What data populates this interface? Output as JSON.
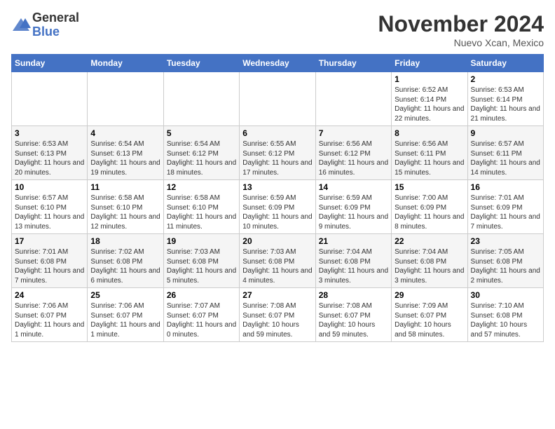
{
  "logo": {
    "general": "General",
    "blue": "Blue"
  },
  "header": {
    "month": "November 2024",
    "location": "Nuevo Xcan, Mexico"
  },
  "weekdays": [
    "Sunday",
    "Monday",
    "Tuesday",
    "Wednesday",
    "Thursday",
    "Friday",
    "Saturday"
  ],
  "weeks": [
    [
      {
        "day": "",
        "info": ""
      },
      {
        "day": "",
        "info": ""
      },
      {
        "day": "",
        "info": ""
      },
      {
        "day": "",
        "info": ""
      },
      {
        "day": "",
        "info": ""
      },
      {
        "day": "1",
        "info": "Sunrise: 6:52 AM\nSunset: 6:14 PM\nDaylight: 11 hours and 22 minutes."
      },
      {
        "day": "2",
        "info": "Sunrise: 6:53 AM\nSunset: 6:14 PM\nDaylight: 11 hours and 21 minutes."
      }
    ],
    [
      {
        "day": "3",
        "info": "Sunrise: 6:53 AM\nSunset: 6:13 PM\nDaylight: 11 hours and 20 minutes."
      },
      {
        "day": "4",
        "info": "Sunrise: 6:54 AM\nSunset: 6:13 PM\nDaylight: 11 hours and 19 minutes."
      },
      {
        "day": "5",
        "info": "Sunrise: 6:54 AM\nSunset: 6:12 PM\nDaylight: 11 hours and 18 minutes."
      },
      {
        "day": "6",
        "info": "Sunrise: 6:55 AM\nSunset: 6:12 PM\nDaylight: 11 hours and 17 minutes."
      },
      {
        "day": "7",
        "info": "Sunrise: 6:56 AM\nSunset: 6:12 PM\nDaylight: 11 hours and 16 minutes."
      },
      {
        "day": "8",
        "info": "Sunrise: 6:56 AM\nSunset: 6:11 PM\nDaylight: 11 hours and 15 minutes."
      },
      {
        "day": "9",
        "info": "Sunrise: 6:57 AM\nSunset: 6:11 PM\nDaylight: 11 hours and 14 minutes."
      }
    ],
    [
      {
        "day": "10",
        "info": "Sunrise: 6:57 AM\nSunset: 6:10 PM\nDaylight: 11 hours and 13 minutes."
      },
      {
        "day": "11",
        "info": "Sunrise: 6:58 AM\nSunset: 6:10 PM\nDaylight: 11 hours and 12 minutes."
      },
      {
        "day": "12",
        "info": "Sunrise: 6:58 AM\nSunset: 6:10 PM\nDaylight: 11 hours and 11 minutes."
      },
      {
        "day": "13",
        "info": "Sunrise: 6:59 AM\nSunset: 6:09 PM\nDaylight: 11 hours and 10 minutes."
      },
      {
        "day": "14",
        "info": "Sunrise: 6:59 AM\nSunset: 6:09 PM\nDaylight: 11 hours and 9 minutes."
      },
      {
        "day": "15",
        "info": "Sunrise: 7:00 AM\nSunset: 6:09 PM\nDaylight: 11 hours and 8 minutes."
      },
      {
        "day": "16",
        "info": "Sunrise: 7:01 AM\nSunset: 6:09 PM\nDaylight: 11 hours and 7 minutes."
      }
    ],
    [
      {
        "day": "17",
        "info": "Sunrise: 7:01 AM\nSunset: 6:08 PM\nDaylight: 11 hours and 7 minutes."
      },
      {
        "day": "18",
        "info": "Sunrise: 7:02 AM\nSunset: 6:08 PM\nDaylight: 11 hours and 6 minutes."
      },
      {
        "day": "19",
        "info": "Sunrise: 7:03 AM\nSunset: 6:08 PM\nDaylight: 11 hours and 5 minutes."
      },
      {
        "day": "20",
        "info": "Sunrise: 7:03 AM\nSunset: 6:08 PM\nDaylight: 11 hours and 4 minutes."
      },
      {
        "day": "21",
        "info": "Sunrise: 7:04 AM\nSunset: 6:08 PM\nDaylight: 11 hours and 3 minutes."
      },
      {
        "day": "22",
        "info": "Sunrise: 7:04 AM\nSunset: 6:08 PM\nDaylight: 11 hours and 3 minutes."
      },
      {
        "day": "23",
        "info": "Sunrise: 7:05 AM\nSunset: 6:08 PM\nDaylight: 11 hours and 2 minutes."
      }
    ],
    [
      {
        "day": "24",
        "info": "Sunrise: 7:06 AM\nSunset: 6:07 PM\nDaylight: 11 hours and 1 minute."
      },
      {
        "day": "25",
        "info": "Sunrise: 7:06 AM\nSunset: 6:07 PM\nDaylight: 11 hours and 1 minute."
      },
      {
        "day": "26",
        "info": "Sunrise: 7:07 AM\nSunset: 6:07 PM\nDaylight: 11 hours and 0 minutes."
      },
      {
        "day": "27",
        "info": "Sunrise: 7:08 AM\nSunset: 6:07 PM\nDaylight: 10 hours and 59 minutes."
      },
      {
        "day": "28",
        "info": "Sunrise: 7:08 AM\nSunset: 6:07 PM\nDaylight: 10 hours and 59 minutes."
      },
      {
        "day": "29",
        "info": "Sunrise: 7:09 AM\nSunset: 6:07 PM\nDaylight: 10 hours and 58 minutes."
      },
      {
        "day": "30",
        "info": "Sunrise: 7:10 AM\nSunset: 6:08 PM\nDaylight: 10 hours and 57 minutes."
      }
    ]
  ]
}
